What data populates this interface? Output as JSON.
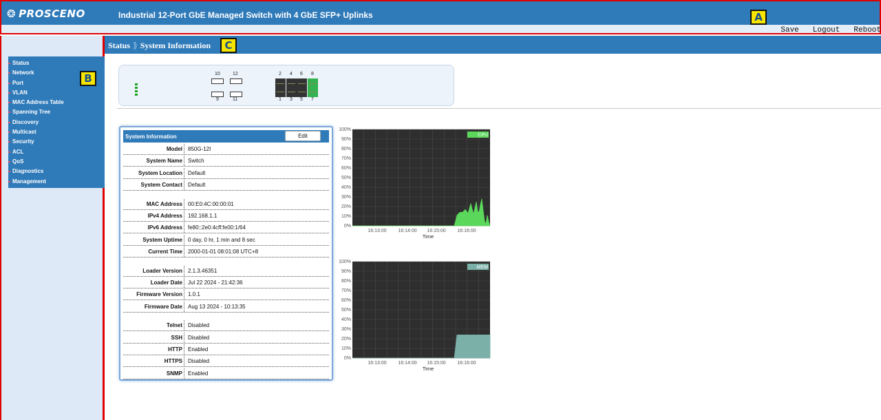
{
  "header": {
    "logo": "PROSCENO",
    "title": "Industrial 12-Port GbE Managed Switch with 4 GbE SFP+ Uplinks",
    "marker_a": "A"
  },
  "actions": {
    "save": "Save",
    "logout": "Logout",
    "reboot": "Reboot"
  },
  "sidebar": {
    "marker_b": "B",
    "items": [
      {
        "label": "Status",
        "active": true
      },
      {
        "label": "Network"
      },
      {
        "label": "Port"
      },
      {
        "label": "VLAN"
      },
      {
        "label": "MAC Address Table"
      },
      {
        "label": "Spanning Tree"
      },
      {
        "label": "Discovery"
      },
      {
        "label": "Multicast"
      },
      {
        "label": "Security"
      },
      {
        "label": "ACL"
      },
      {
        "label": "QoS"
      },
      {
        "label": "Diagnostics"
      },
      {
        "label": "Management"
      }
    ]
  },
  "breadcrumb": {
    "parent": "Status",
    "separator": "⟫",
    "current": "System Information",
    "marker_c": "C"
  },
  "ports": {
    "top": [
      "10",
      "12",
      "2",
      "4",
      "6",
      "8"
    ],
    "bottom": [
      "9",
      "11",
      "1",
      "3",
      "5",
      "7"
    ]
  },
  "system_info": {
    "title": "System Information",
    "edit_label": "Edit",
    "rows": [
      {
        "label": "Model",
        "value": "850G-12I"
      },
      {
        "label": "System Name",
        "value": "Switch"
      },
      {
        "label": "System Location",
        "value": "Default"
      },
      {
        "label": "System Contact",
        "value": "Default"
      },
      {
        "label": "MAC Address",
        "value": "00:E0:4C:00:00:01"
      },
      {
        "label": "IPv4 Address",
        "value": "192.168.1.1"
      },
      {
        "label": "IPv6 Address",
        "value": "fe80::2e0:4cff:fe00:1/64"
      },
      {
        "label": "System Uptime",
        "value": "0 day, 0 hr, 1 min and 8 sec"
      },
      {
        "label": "Current Time",
        "value": "2000-01-01 08:01:08 UTC+8"
      },
      {
        "label": "Loader Version",
        "value": "2.1.3.46351"
      },
      {
        "label": "Loader Date",
        "value": "Jul 22 2024 - 21:42:36"
      },
      {
        "label": "Firmware Version",
        "value": "1.0.1"
      },
      {
        "label": "Firmware Date",
        "value": "Aug 13 2024 - 10:13:35"
      },
      {
        "label": "Telnet",
        "value": "Disabled"
      },
      {
        "label": "SSH",
        "value": "Disabled"
      },
      {
        "label": "HTTP",
        "value": "Enabled"
      },
      {
        "label": "HTTPS",
        "value": "Disabled"
      },
      {
        "label": "SNMP",
        "value": "Enabled"
      }
    ]
  },
  "chart_data": [
    {
      "type": "area",
      "legend": "CPU",
      "legend_placement": "top-right",
      "color": "#5bd85b",
      "bg": "#2e2e2e",
      "xlabel": "Time",
      "x_ticks": [
        "16:13:00",
        "16:14:00",
        "16:15:00",
        "16:16:00"
      ],
      "y_ticks": [
        "0%",
        "10%",
        "20%",
        "30%",
        "40%",
        "50%",
        "60%",
        "70%",
        "80%",
        "90%",
        "100%"
      ],
      "ylim": [
        0,
        100
      ],
      "grid": true,
      "x": [
        0,
        10,
        20,
        30,
        40,
        50,
        60,
        70,
        74,
        76,
        78,
        80,
        82,
        84,
        86,
        88,
        90,
        91,
        92,
        93,
        94,
        95,
        96,
        97,
        98,
        99,
        100
      ],
      "values": [
        0,
        0,
        0,
        0,
        0,
        0,
        0,
        0,
        0,
        11,
        14,
        14,
        17,
        13,
        23,
        12,
        25,
        15,
        14,
        22,
        28,
        16,
        5,
        2,
        11,
        4,
        0
      ]
    },
    {
      "type": "area",
      "legend": "MEM",
      "legend_placement": "top-right",
      "color": "#7ab0a8",
      "bg": "#2e2e2e",
      "xlabel": "Time",
      "x_ticks": [
        "16:13:00",
        "16:14:00",
        "16:15:00",
        "16:16:00"
      ],
      "y_ticks": [
        "0%",
        "10%",
        "20%",
        "30%",
        "40%",
        "50%",
        "60%",
        "70%",
        "80%",
        "90%",
        "100%"
      ],
      "ylim": [
        0,
        100
      ],
      "grid": true,
      "x": [
        0,
        10,
        20,
        30,
        40,
        50,
        60,
        70,
        74,
        76,
        100
      ],
      "values": [
        0,
        0,
        0,
        0,
        0,
        0,
        0,
        0,
        0,
        24,
        24
      ]
    }
  ]
}
